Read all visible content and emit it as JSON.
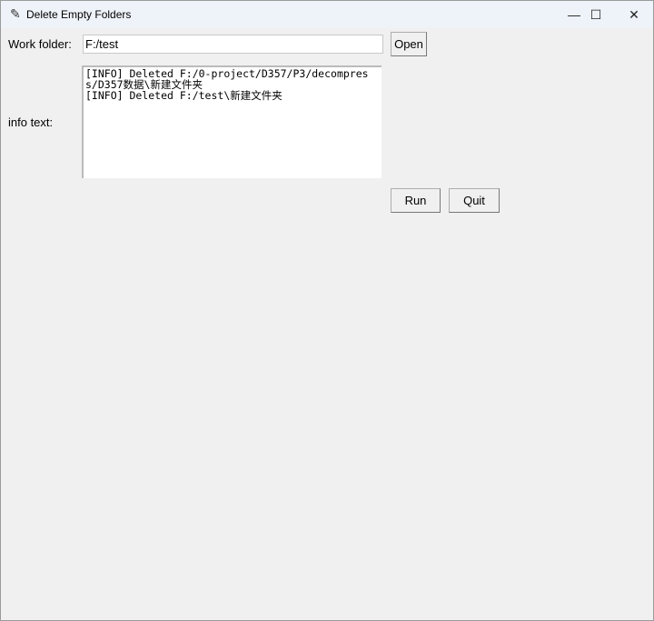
{
  "window": {
    "title": "Delete Empty Folders",
    "minimize": "—",
    "maximize": "☐",
    "close": "✕"
  },
  "form": {
    "work_folder_label": "Work folder:",
    "work_folder_value": "F:/test",
    "open_label": "Open",
    "info_label": "info text:",
    "info_text": "[INFO] Deleted F:/0-project/D357/P3/decompress/D357数据\\新建文件夹\n[INFO] Deleted F:/test\\新建文件夹",
    "run_label": "Run",
    "quit_label": "Quit"
  }
}
